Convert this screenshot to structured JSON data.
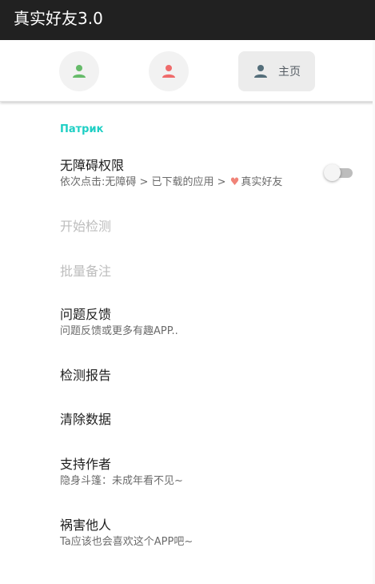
{
  "app": {
    "title": "真实好友3.0"
  },
  "tabs": [
    {
      "icon": "person-icon",
      "color": "#66bb6a"
    },
    {
      "icon": "person-icon",
      "color": "#ef6b6b"
    },
    {
      "icon": "person-icon",
      "color": "#546e7a",
      "label": "主页",
      "selected": true
    }
  ],
  "section": {
    "header": "Патрик"
  },
  "items": [
    {
      "title": "无障碍权限",
      "subtitle_before": "依次点击:无障碍 > 已下载的应用 > ",
      "subtitle_after": "真实好友",
      "toggle": false
    },
    {
      "title": "开始检测",
      "disabled": true
    },
    {
      "title": "批量备注",
      "disabled": true
    },
    {
      "title": "问题反馈",
      "subtitle": "问题反馈或更多有趣APP.."
    },
    {
      "title": "检测报告"
    },
    {
      "title": "清除数据"
    },
    {
      "title": "支持作者",
      "subtitle": "隐身斗篷：未成年看不见~"
    },
    {
      "title": "祸害他人",
      "subtitle": "Ta应该也会喜欢这个APP吧~"
    }
  ]
}
